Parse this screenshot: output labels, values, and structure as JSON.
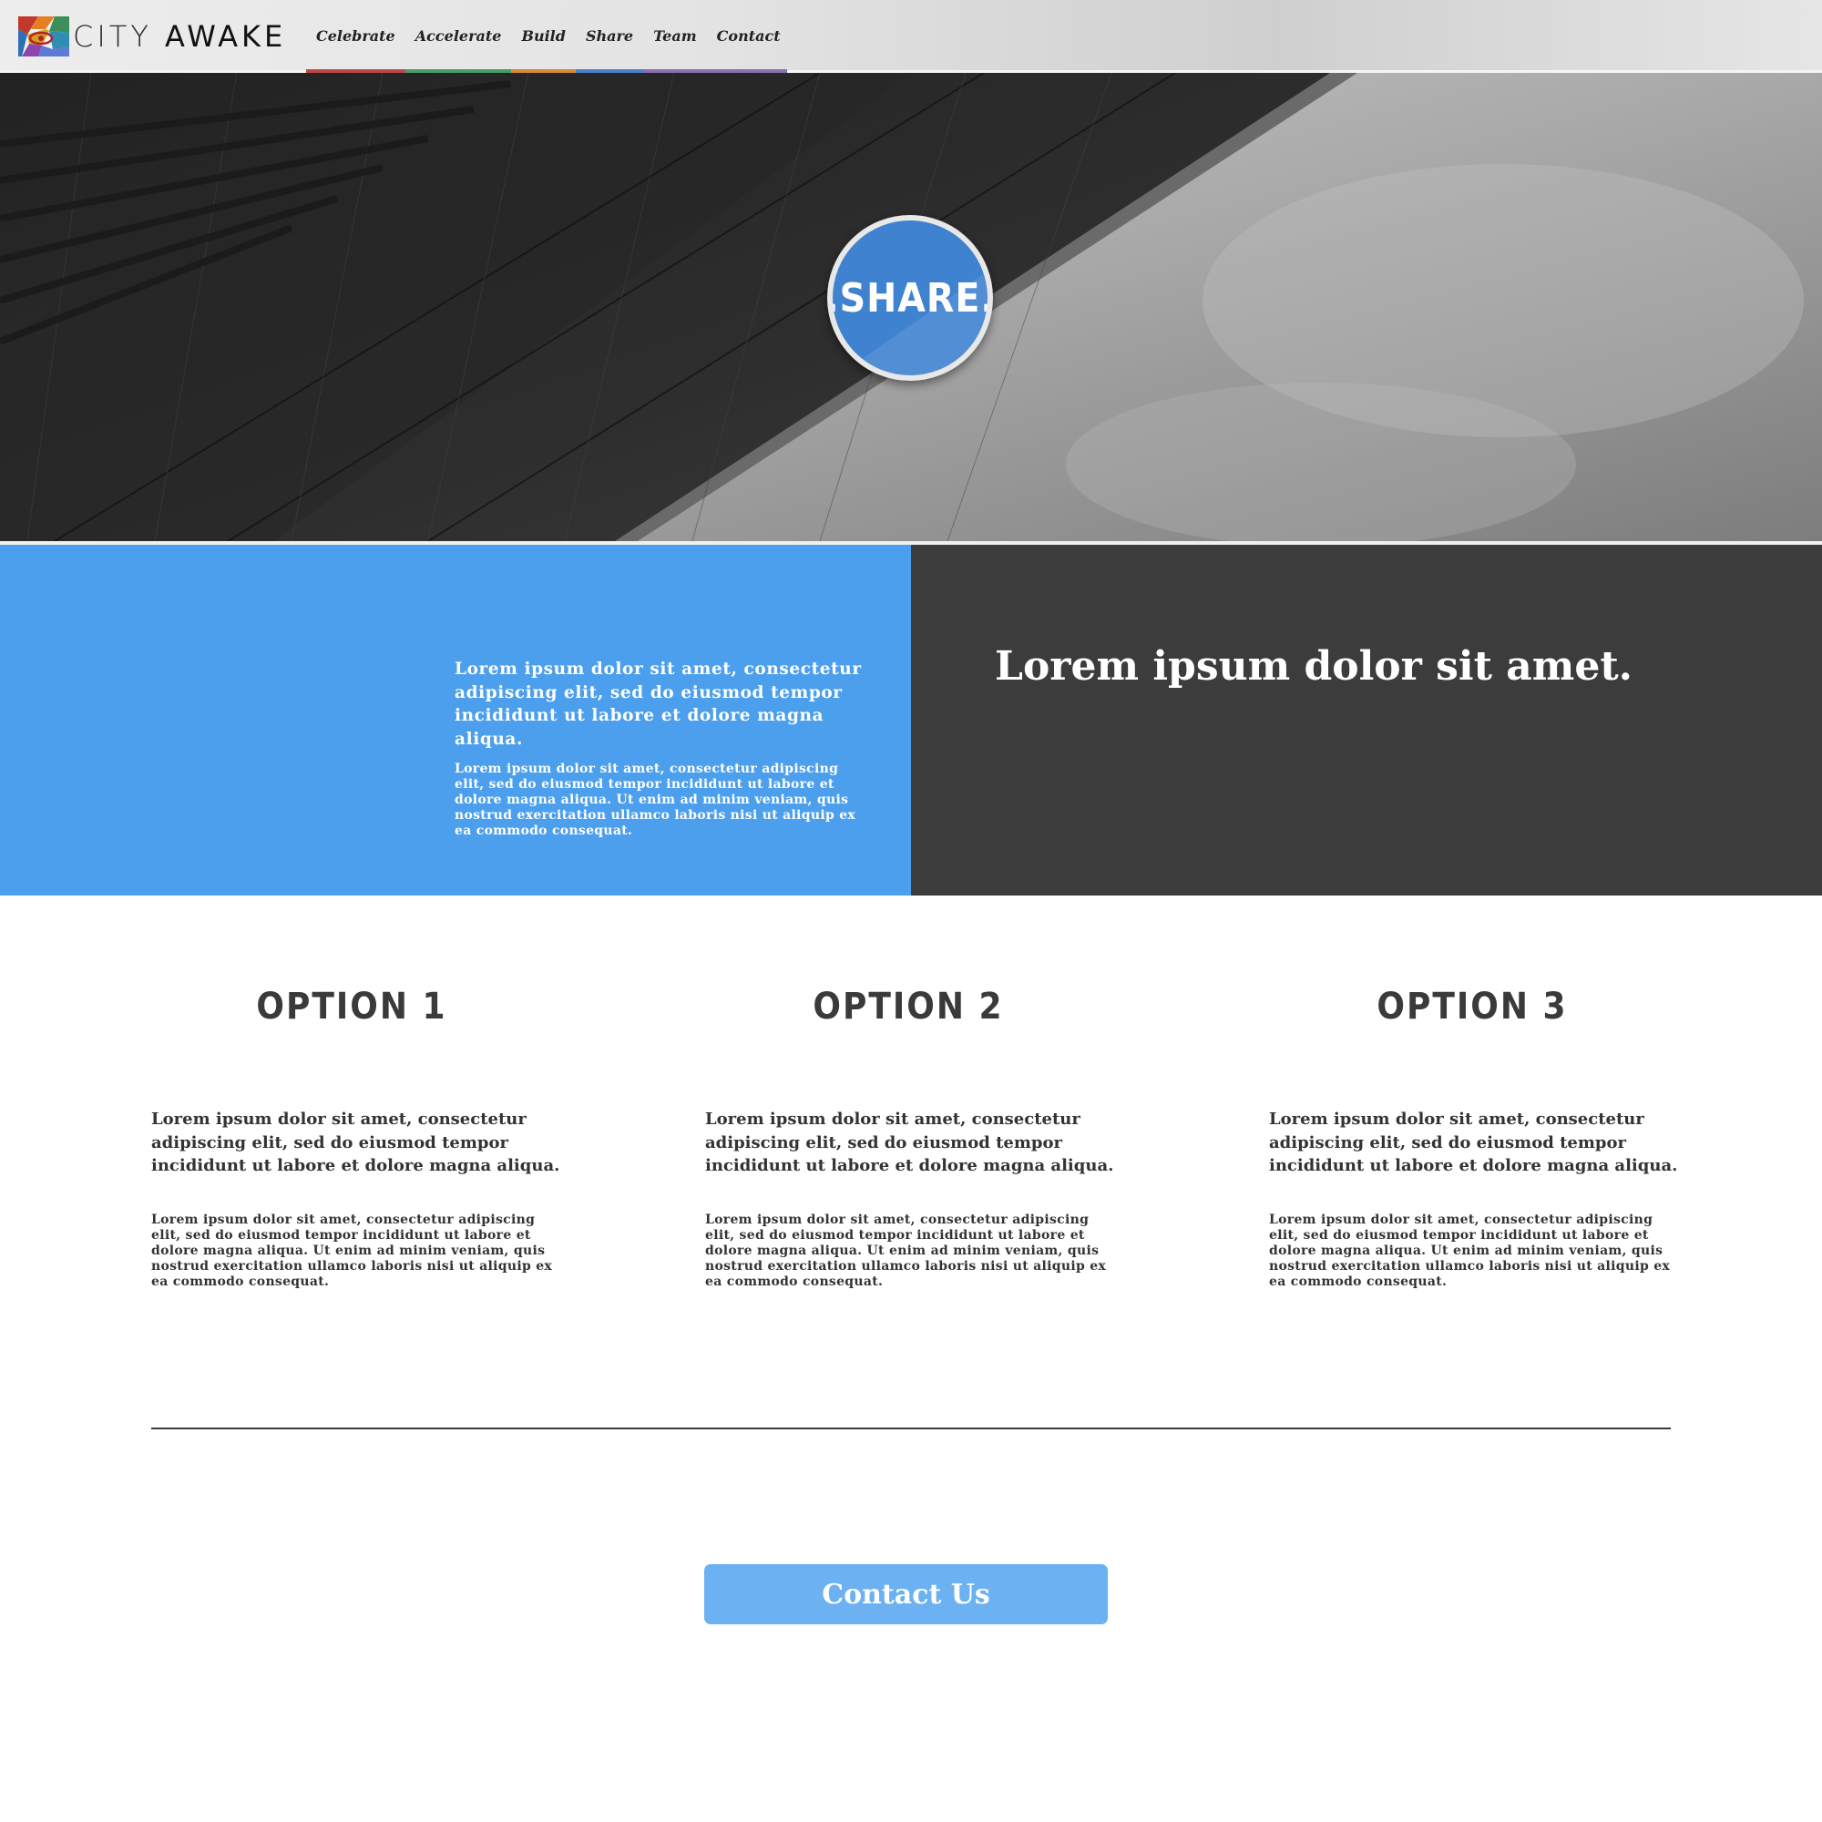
{
  "nav": {
    "brand": {
      "city": "CITY",
      "awake": "AWAKE"
    },
    "items": [
      {
        "label": "Celebrate",
        "color": "#b94a4a"
      },
      {
        "label": "Accelerate",
        "color": "#4a9b67"
      },
      {
        "label": "Build",
        "color": "#d58b2f"
      },
      {
        "label": "Share",
        "color": "#4a82c9"
      },
      {
        "label": "Team",
        "color": "#8a6fb1"
      },
      {
        "label": "Contact",
        "color": "#8a6fb1"
      }
    ]
  },
  "hero": {
    "badge_text": ".SHARE.",
    "badge_color": "#3f82cf"
  },
  "intro": {
    "lead": "Lorem ipsum dolor sit amet, consectetur adipiscing elit, sed do eiusmod tempor incididunt ut labore et dolore magna aliqua.",
    "body": "Lorem ipsum dolor sit amet, consectetur adipiscing elit, sed do eiusmod tempor incididunt ut labore et dolore magna aliqua. Ut enim ad minim veniam, quis nostrud exercitation ullamco laboris nisi ut aliquip ex ea commodo consequat.",
    "heading": "Lorem ipsum dolor sit amet.",
    "left_color": "#4c9fec",
    "right_color": "#3c3c3c"
  },
  "options": [
    {
      "title": "OPTION 1",
      "lead": "Lorem ipsum dolor sit amet, consectetur adipiscing elit, sed do eiusmod tempor incididunt ut labore et dolore magna aliqua.",
      "body": "Lorem ipsum dolor sit amet, consectetur adipiscing elit, sed do eiusmod tempor incididunt ut labore et dolore magna aliqua. Ut enim ad minim veniam, quis nostrud exercitation ullamco laboris nisi ut aliquip ex ea commodo consequat."
    },
    {
      "title": "OPTION 2",
      "lead": "Lorem ipsum dolor sit amet, consectetur adipiscing elit, sed do eiusmod tempor incididunt ut labore et dolore magna aliqua.",
      "body": "Lorem ipsum dolor sit amet, consectetur adipiscing elit, sed do eiusmod tempor incididunt ut labore et dolore magna aliqua. Ut enim ad minim veniam, quis nostrud exercitation ullamco laboris nisi ut aliquip ex ea commodo consequat."
    },
    {
      "title": "OPTION 3",
      "lead": "Lorem ipsum dolor sit amet, consectetur adipiscing elit, sed do eiusmod tempor incididunt ut labore et dolore magna aliqua.",
      "body": "Lorem ipsum dolor sit amet, consectetur adipiscing elit, sed do eiusmod tempor incididunt ut labore et dolore magna aliqua. Ut enim ad minim veniam, quis nostrud exercitation ullamco laboris nisi ut aliquip ex ea commodo consequat."
    }
  ],
  "cta": {
    "label": "Contact Us",
    "color": "#6cb1f1"
  }
}
